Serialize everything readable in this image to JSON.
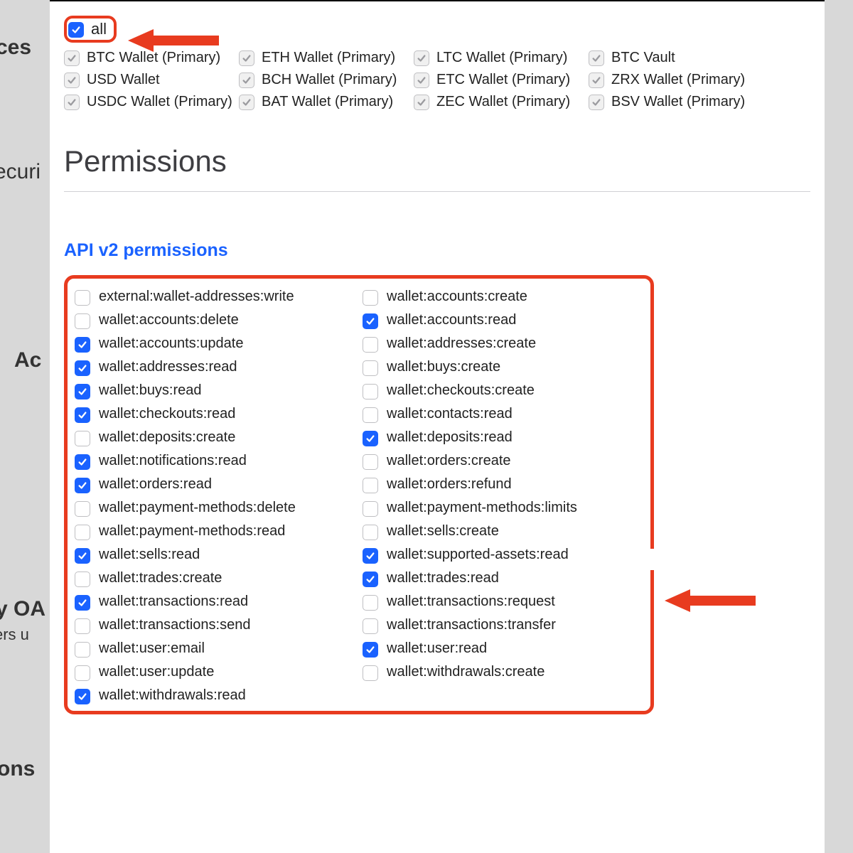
{
  "background": {
    "ces": "ces",
    "securi": "ecuri",
    "ac": "Ac",
    "oauth": "y OA",
    "ners_u": "ers u",
    "ons": "ons"
  },
  "wallets": {
    "all_label": "all",
    "items": [
      {
        "label": "BTC Wallet (Primary)"
      },
      {
        "label": "ETH Wallet (Primary)"
      },
      {
        "label": "LTC Wallet (Primary)"
      },
      {
        "label": "BTC Vault"
      },
      {
        "label": "USD Wallet"
      },
      {
        "label": "BCH Wallet (Primary)"
      },
      {
        "label": "ETC Wallet (Primary)"
      },
      {
        "label": "ZRX Wallet (Primary)"
      },
      {
        "label": "USDC Wallet (Primary)"
      },
      {
        "label": "BAT Wallet (Primary)"
      },
      {
        "label": "ZEC Wallet (Primary)"
      },
      {
        "label": "BSV Wallet (Primary)"
      }
    ]
  },
  "permissions_heading": "Permissions",
  "api_title": "API v2 permissions",
  "permissions": [
    {
      "label": "external:wallet-addresses:write",
      "checked": false
    },
    {
      "label": "wallet:accounts:create",
      "checked": false
    },
    {
      "label": "wallet:accounts:delete",
      "checked": false
    },
    {
      "label": "wallet:accounts:read",
      "checked": true
    },
    {
      "label": "wallet:accounts:update",
      "checked": true
    },
    {
      "label": "wallet:addresses:create",
      "checked": false
    },
    {
      "label": "wallet:addresses:read",
      "checked": true
    },
    {
      "label": "wallet:buys:create",
      "checked": false
    },
    {
      "label": "wallet:buys:read",
      "checked": true
    },
    {
      "label": "wallet:checkouts:create",
      "checked": false
    },
    {
      "label": "wallet:checkouts:read",
      "checked": true
    },
    {
      "label": "wallet:contacts:read",
      "checked": false
    },
    {
      "label": "wallet:deposits:create",
      "checked": false
    },
    {
      "label": "wallet:deposits:read",
      "checked": true
    },
    {
      "label": "wallet:notifications:read",
      "checked": true
    },
    {
      "label": "wallet:orders:create",
      "checked": false
    },
    {
      "label": "wallet:orders:read",
      "checked": true
    },
    {
      "label": "wallet:orders:refund",
      "checked": false
    },
    {
      "label": "wallet:payment-methods:delete",
      "checked": false
    },
    {
      "label": "wallet:payment-methods:limits",
      "checked": false
    },
    {
      "label": "wallet:payment-methods:read",
      "checked": false
    },
    {
      "label": "wallet:sells:create",
      "checked": false
    },
    {
      "label": "wallet:sells:read",
      "checked": true
    },
    {
      "label": "wallet:supported-assets:read",
      "checked": true
    },
    {
      "label": "wallet:trades:create",
      "checked": false
    },
    {
      "label": "wallet:trades:read",
      "checked": true
    },
    {
      "label": "wallet:transactions:read",
      "checked": true
    },
    {
      "label": "wallet:transactions:request",
      "checked": false
    },
    {
      "label": "wallet:transactions:send",
      "checked": false
    },
    {
      "label": "wallet:transactions:transfer",
      "checked": false
    },
    {
      "label": "wallet:user:email",
      "checked": false
    },
    {
      "label": "wallet:user:read",
      "checked": true
    },
    {
      "label": "wallet:user:update",
      "checked": false
    },
    {
      "label": "wallet:withdrawals:create",
      "checked": false
    },
    {
      "label": "wallet:withdrawals:read",
      "checked": true
    }
  ]
}
